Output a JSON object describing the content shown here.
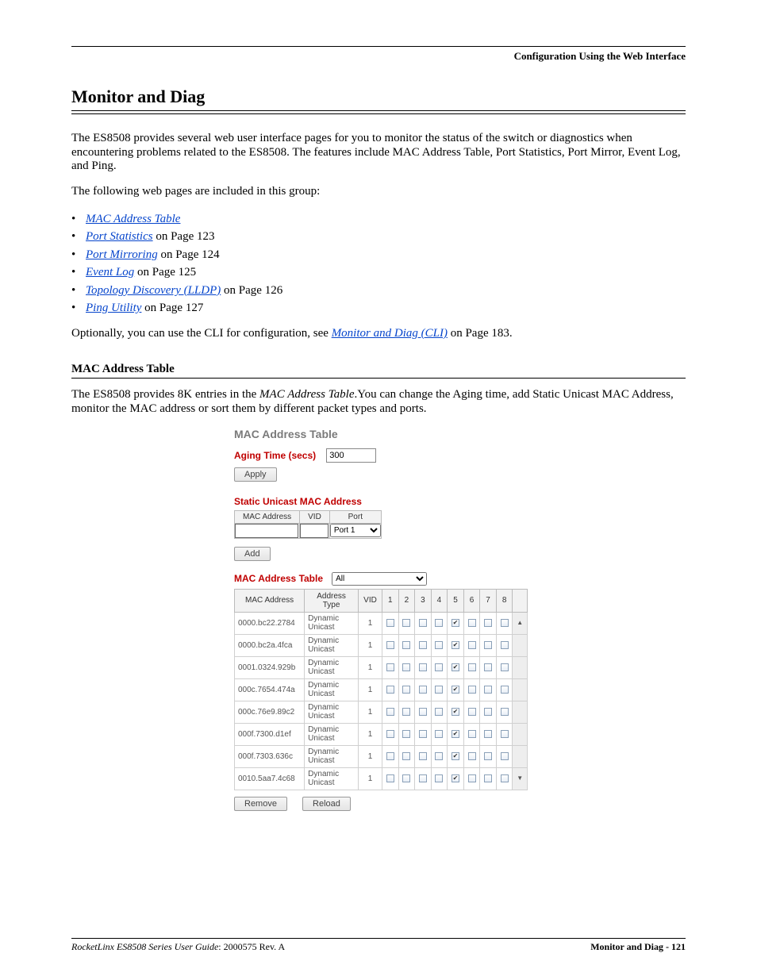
{
  "header": {
    "right": "Configuration Using the Web Interface"
  },
  "title": "Monitor and Diag",
  "intro": "The ES8508 provides several web user interface pages for you to monitor the status of the switch or diagnostics when encountering problems related to the ES8508. The features include MAC Address Table, Port Statistics, Port Mirror, Event Log, and Ping.",
  "following": "The following web pages are included in this group:",
  "links": [
    {
      "label": "MAC Address Table",
      "suffix": ""
    },
    {
      "label": "Port Statistics",
      "suffix": " on Page 123"
    },
    {
      "label": "Port Mirroring",
      "suffix": " on Page 124"
    },
    {
      "label": "Event Log",
      "suffix": " on Page 125"
    },
    {
      "label": "Topology Discovery (LLDP)",
      "suffix": " on Page 126"
    },
    {
      "label": "Ping Utility",
      "suffix": " on Page 127"
    }
  ],
  "optional_pre": "Optionally, you can use the CLI for configuration, see ",
  "optional_link": "Monitor and Diag (CLI)",
  "optional_post": " on Page 183.",
  "sub_heading": "MAC Address Table",
  "sub_para_a": "The ES8508 provides 8K entries in the ",
  "sub_para_em": "MAC Address Table",
  "sub_para_b": ".You can change the Aging time, add Static Unicast MAC Address, monitor the MAC address or sort them by different packet types and ports.",
  "ui": {
    "panel_title": "MAC Address Table",
    "aging_label": "Aging Time (secs)",
    "aging_value": "300",
    "apply": "Apply",
    "static_title": "Static Unicast MAC Address",
    "cols": {
      "mac": "MAC Address",
      "vid": "VID",
      "port": "Port"
    },
    "port_value": "Port 1",
    "add": "Add",
    "filter_label": "MAC Address Table",
    "filter_value": "All",
    "table_headers": [
      "MAC Address",
      "Address Type",
      "VID",
      "1",
      "2",
      "3",
      "4",
      "5",
      "6",
      "7",
      "8"
    ],
    "rows": [
      {
        "mac": "0000.bc22.2784",
        "type": "Dynamic Unicast",
        "vid": "1",
        "on": 5
      },
      {
        "mac": "0000.bc2a.4fca",
        "type": "Dynamic Unicast",
        "vid": "1",
        "on": 5
      },
      {
        "mac": "0001.0324.929b",
        "type": "Dynamic Unicast",
        "vid": "1",
        "on": 5
      },
      {
        "mac": "000c.7654.474a",
        "type": "Dynamic Unicast",
        "vid": "1",
        "on": 5
      },
      {
        "mac": "000c.76e9.89c2",
        "type": "Dynamic Unicast",
        "vid": "1",
        "on": 5
      },
      {
        "mac": "000f.7300.d1ef",
        "type": "Dynamic Unicast",
        "vid": "1",
        "on": 5
      },
      {
        "mac": "000f.7303.636c",
        "type": "Dynamic Unicast",
        "vid": "1",
        "on": 5
      },
      {
        "mac": "0010.5aa7.4c68",
        "type": "Dynamic Unicast",
        "vid": "1",
        "on": 5
      }
    ],
    "remove": "Remove",
    "reload": "Reload"
  },
  "footer": {
    "left_italic": "RocketLinx ES8508 Series  User Guide",
    "left_rest": ": 2000575 Rev. A",
    "right": "Monitor and Diag - 121"
  }
}
